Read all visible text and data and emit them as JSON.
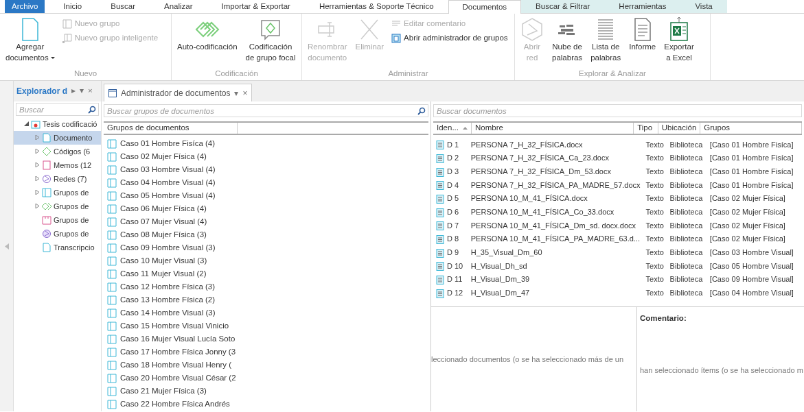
{
  "menu_tabs": [
    {
      "label": "Archivo",
      "kind": "file",
      "selected": false
    },
    {
      "label": "Inicio",
      "kind": "normal",
      "selected": false
    },
    {
      "label": "Buscar",
      "kind": "normal",
      "selected": false
    },
    {
      "label": "Analizar",
      "kind": "normal",
      "selected": false
    },
    {
      "label": "Importar & Exportar",
      "kind": "normal",
      "selected": false
    },
    {
      "label": "Herramientas & Soporte Técnico",
      "kind": "normal",
      "selected": false
    },
    {
      "label": "Documentos",
      "kind": "normal",
      "selected": true
    },
    {
      "label": "Buscar & Filtrar",
      "kind": "contextual",
      "selected": false
    },
    {
      "label": "Herramientas",
      "kind": "contextual",
      "selected": false
    },
    {
      "label": "Vista",
      "kind": "contextual",
      "selected": false
    }
  ],
  "ribbon_groups": [
    {
      "title": "Nuevo",
      "items": [
        {
          "kind": "large",
          "lines": [
            "Agregar",
            "documentos"
          ],
          "dropdown": true,
          "disabled": false
        },
        {
          "kind": "small",
          "label": "Nuevo grupo",
          "disabled": true
        },
        {
          "kind": "small",
          "label": "Nuevo grupo inteligente",
          "disabled": true
        }
      ]
    },
    {
      "title": "Codificación",
      "items": [
        {
          "kind": "large",
          "lines": [
            "Auto-codificación"
          ],
          "disabled": false
        },
        {
          "kind": "large",
          "lines": [
            "Codificación",
            "de grupo focal"
          ],
          "disabled": false
        }
      ]
    },
    {
      "title": "Administrar",
      "items": [
        {
          "kind": "large",
          "lines": [
            "Renombrar",
            "documento"
          ],
          "disabled": true
        },
        {
          "kind": "large",
          "lines": [
            "Eliminar"
          ],
          "disabled": true
        },
        {
          "kind": "small",
          "label": "Editar comentario",
          "disabled": true
        },
        {
          "kind": "small",
          "label": "Abrir administrador de grupos",
          "disabled": false
        }
      ]
    },
    {
      "title": "Explorar & Analizar",
      "items": [
        {
          "kind": "large",
          "lines": [
            "Abrir",
            "red"
          ],
          "disabled": true
        },
        {
          "kind": "large",
          "lines": [
            "Nube de",
            "palabras"
          ],
          "disabled": false
        },
        {
          "kind": "large",
          "lines": [
            "Lista de",
            "palabras"
          ],
          "disabled": false
        },
        {
          "kind": "large",
          "lines": [
            "Informe"
          ],
          "disabled": false
        },
        {
          "kind": "large",
          "lines": [
            "Exportar",
            "a Excel"
          ],
          "disabled": false
        }
      ]
    }
  ],
  "explorer": {
    "title": "Explorador d",
    "controls": [
      "▸",
      "▾",
      "×"
    ],
    "search": {
      "placeholder": "Buscar"
    },
    "tree": [
      {
        "label": "Tesis codificació",
        "expanded": true,
        "selected": false,
        "children": [
          {
            "label": "Documento",
            "expanded": false,
            "selected": true
          },
          {
            "label": "Códigos (6",
            "expanded": false,
            "selected": false
          },
          {
            "label": "Memos (12",
            "expanded": false,
            "selected": false
          },
          {
            "label": "Redes (7)",
            "expanded": false,
            "selected": false
          },
          {
            "label": "Grupos de",
            "expanded": false,
            "selected": false
          },
          {
            "label": "Grupos de",
            "expanded": false,
            "selected": false
          },
          {
            "label": "Grupos de",
            "selected": false
          },
          {
            "label": "Grupos de",
            "selected": false
          },
          {
            "label": "Transcripcio",
            "selected": false
          }
        ]
      }
    ]
  },
  "manager_tab": {
    "title": "Administrador de documentos",
    "controls": [
      "▾",
      "×"
    ]
  },
  "groups_panel": {
    "search": {
      "placeholder": "Buscar grupos de documentos"
    },
    "columns": [
      "Grupos de documentos"
    ],
    "rows": [
      "Caso 01 Hombre Fisíca (4)",
      "Caso 02 Mujer Física (4)",
      "Caso 03 Hombre Visual (4)",
      "Caso 04 Hombre Visual (4)",
      "Caso 05 Hombre Visual (4)",
      "Caso 06 Mujer Física (4)",
      "Caso 07 Mujer Visual (4)",
      "Caso 08 Mujer Física (3)",
      "Caso 09 Hombre Visual (3)",
      "Caso 10 Mujer Visual (3)",
      "Caso 11 Mujer Visual (2)",
      "Caso 12 Hombre Física (3)",
      "Caso 13 Hombre Física (2)",
      "Caso 14 Hombre Visual (3)",
      "Caso 15 Hombre Visual Vinicio",
      "Caso 16 Mujer Visual Lucía Soto",
      "Caso 17 Hombre Física Jonny (3",
      "Caso 18 Hombre Visual Henry (",
      "Caso 20 Hombre Visual César (2",
      "Caso 21 Mujer Física (3)",
      "Caso 22 Hombre Física Andrés"
    ]
  },
  "documents_panel": {
    "search": {
      "placeholder": "Buscar documentos"
    },
    "columns": [
      {
        "label": "Iden...",
        "sort_ascending": true
      },
      {
        "label": "Nombre"
      },
      {
        "label": "Tipo"
      },
      {
        "label": "Ubicación"
      },
      {
        "label": "Grupos"
      }
    ],
    "rows": [
      [
        "D 1",
        "PERSONA 7_H_32_FÍSICA.docx",
        "Texto",
        "Biblioteca",
        "[Caso 01 Hombre Fisíca]"
      ],
      [
        "D 2",
        "PERSONA 7_H_32_FÍSICA_Ca_23.docx",
        "Texto",
        "Biblioteca",
        "[Caso 01 Hombre Fisíca]"
      ],
      [
        "D 3",
        "PERSONA 7_H_32_FÍSICA_Dm_53.docx",
        "Texto",
        "Biblioteca",
        "[Caso 01 Hombre Fisíca]"
      ],
      [
        "D 4",
        "PERSONA 7_H_32_FÍSICA_PA_MADRE_57.docx",
        "Texto",
        "Biblioteca",
        "[Caso 01 Hombre Fisíca]"
      ],
      [
        "D 5",
        "PERSONA 10_M_41_FÍSICA.docx",
        "Texto",
        "Biblioteca",
        "[Caso 02 Mujer Física]"
      ],
      [
        "D 6",
        "PERSONA 10_M_41_FÍSICA_Co_33.docx",
        "Texto",
        "Biblioteca",
        "[Caso 02 Mujer Física]"
      ],
      [
        "D 7",
        "PERSONA 10_M_41_FÍSICA_Dm_sd. docx.docx",
        "Texto",
        "Biblioteca",
        "[Caso 02 Mujer Física]"
      ],
      [
        "D 8",
        "PERSONA 10_M_41_FÍSICA_PA_MADRE_63.d...",
        "Texto",
        "Biblioteca",
        "[Caso 02 Mujer Física]"
      ],
      [
        "D 9",
        "H_35_Visual_Dm_60",
        "Texto",
        "Biblioteca",
        "[Caso 03 Hombre Visual]"
      ],
      [
        "D 10",
        "H_Visual_Dh_sd",
        "Texto",
        "Biblioteca",
        "[Caso 05 Hombre Visual]"
      ],
      [
        "D 11",
        "H_Visual_Dm_39",
        "Texto",
        "Biblioteca",
        "[Caso 09 Hombre Visual]"
      ],
      [
        "D 12",
        "H_Visual_Dm_47",
        "Texto",
        "Biblioteca",
        "[Caso 04 Hombre Visual]"
      ]
    ],
    "preview_message": "leccionado documentos (o se ha seleccionado más de un",
    "comment": {
      "title": "Comentario:",
      "message": "han seleccionado ítems (o se ha seleccionado m"
    }
  }
}
